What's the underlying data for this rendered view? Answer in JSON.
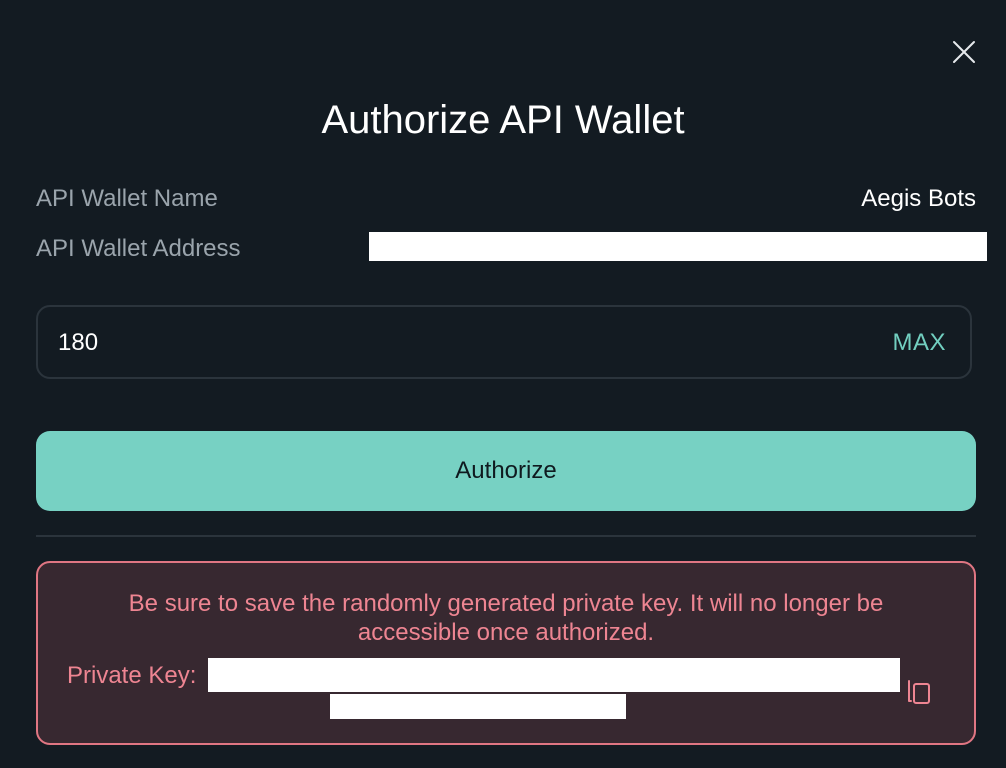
{
  "modal": {
    "title": "Authorize API Wallet",
    "close_icon": "close-icon"
  },
  "wallet": {
    "name_label": "API Wallet Name",
    "name_value": "Aegis Bots",
    "address_label": "API Wallet Address",
    "address_value": ""
  },
  "amount": {
    "value": "180",
    "max_label": "MAX"
  },
  "authorize_button": {
    "label": "Authorize"
  },
  "warning": {
    "message": "Be sure to save the randomly generated private key. It will no longer be accessible once authorized.",
    "private_key_label": "Private Key:",
    "private_key_value": "",
    "copy_icon": "copy-icon"
  },
  "colors": {
    "background": "#131b22",
    "accent": "#77d1c3",
    "accent_text": "#72cfc0",
    "warning_text": "#ee8592",
    "warning_border": "#e07683",
    "warning_bg": "#372830",
    "muted_text": "#9aa4ac"
  }
}
